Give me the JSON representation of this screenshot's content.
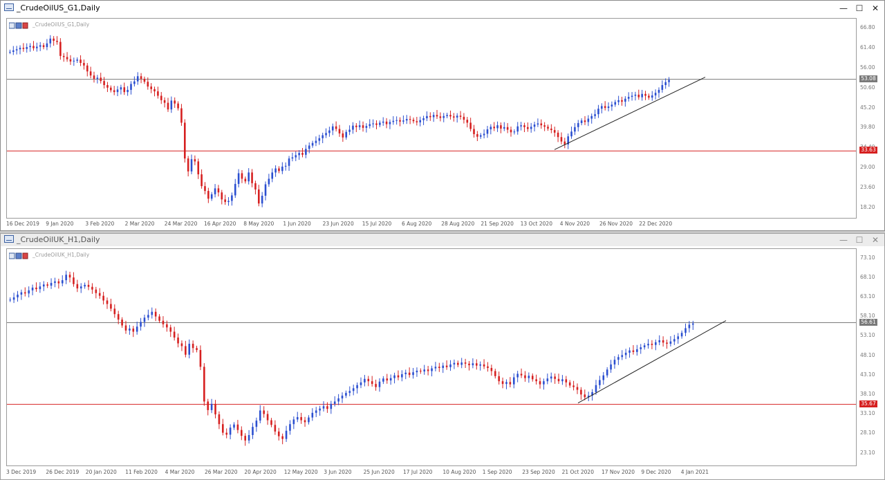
{
  "charts": [
    {
      "window_title": "_CrudeOilUS_G1,Daily",
      "chart_label": "_CrudeOilUS_G1,Daily",
      "price_labels": [
        "66.80",
        "61.40",
        "56.00",
        "50.60",
        "45.20",
        "39.80",
        "34.40",
        "29.00",
        "23.60",
        "18.20"
      ],
      "price_min": 15.5,
      "price_max": 69.5,
      "date_labels": [
        "16 Dec 2019",
        "9 Jan 2020",
        "3 Feb 2020",
        "2 Mar 2020",
        "24 Mar 2020",
        "16 Apr 2020",
        "8 May 2020",
        "1 Jun 2020",
        "23 Jun 2020",
        "15 Jul 2020",
        "6 Aug 2020",
        "28 Aug 2020",
        "21 Sep 2020",
        "13 Oct 2020",
        "4 Nov 2020",
        "26 Nov 2020",
        "22 Dec 2020"
      ],
      "hline_gray": {
        "label": "53.08",
        "value": 53.08,
        "color": "#7a7a7a"
      },
      "hline_red": {
        "label": "33.63",
        "value": 33.63,
        "color": "#d62020"
      },
      "trendline": {
        "from": {
          "bar": 0.0,
          "price": 0
        },
        "note": ""
      },
      "closes": [
        60.5,
        60.9,
        61.2,
        61.6,
        61.3,
        61.8,
        62.1,
        61.5,
        61.9,
        62.3,
        61.8,
        62.8,
        64.1,
        63.5,
        63.2,
        59.4,
        59.1,
        58.5,
        57.9,
        58.1,
        58.4,
        57.5,
        56.8,
        55.2,
        54.1,
        53.2,
        53.5,
        52.6,
        51.5,
        50.8,
        50.1,
        49.6,
        50.3,
        50.9,
        49.6,
        50.2,
        51.8,
        52.5,
        53.9,
        53.2,
        52.4,
        51.1,
        50.4,
        49.8,
        48.6,
        47.4,
        46.7,
        44.9,
        47.3,
        46.5,
        45.2,
        41.3,
        31.6,
        28.1,
        31.4,
        30.8,
        27.3,
        24.1,
        22.8,
        20.7,
        21.9,
        23.5,
        22.4,
        20.5,
        19.8,
        20.1,
        21.6,
        24.7,
        27.6,
        26.1,
        25.4,
        27.8,
        24.9,
        23.2,
        19.4,
        21.5,
        24.6,
        26.1,
        27.8,
        28.9,
        28.2,
        29.4,
        29.6,
        31.6,
        31.9,
        32.5,
        33.1,
        32.6,
        34.2,
        35.1,
        35.8,
        36.4,
        37.1,
        37.9,
        38.5,
        39.2,
        40.3,
        39.6,
        38.4,
        37.3,
        38.8,
        39.4,
        40.5,
        40.1,
        40.6,
        39.9,
        40.4,
        40.9,
        41.1,
        40.7,
        41.3,
        41.6,
        40.9,
        41.5,
        41.8,
        42.0,
        41.6,
        41.9,
        42.3,
        42.1,
        41.7,
        41.4,
        42.0,
        42.5,
        43.1,
        42.8,
        43.4,
        43.0,
        42.6,
        43.1,
        43.4,
        43.0,
        42.7,
        43.2,
        42.9,
        42.1,
        41.3,
        39.6,
        38.2,
        37.5,
        37.9,
        38.3,
        39.5,
        40.2,
        39.8,
        40.6,
        39.7,
        40.1,
        39.4,
        38.7,
        38.9,
        40.3,
        40.6,
        40.1,
        39.6,
        40.2,
        40.8,
        41.1,
        40.6,
        40.2,
        39.7,
        39.3,
        38.6,
        37.4,
        36.2,
        35.4,
        37.6,
        38.9,
        40.1,
        41.2,
        41.9,
        41.5,
        42.4,
        43.1,
        43.6,
        45.1,
        45.8,
        45.3,
        45.7,
        46.2,
        46.9,
        47.4,
        47.0,
        47.8,
        48.3,
        48.6,
        48.9,
        48.2,
        49.1,
        48.6,
        48.1,
        48.7,
        49.4,
        50.2,
        51.5,
        52.3,
        52.9
      ]
    },
    {
      "window_title": "_CrudeOilUK_H1,Daily",
      "chart_label": "_CrudeOilUK_H1,Daily",
      "price_labels": [
        "73.10",
        "68.10",
        "63.10",
        "58.10",
        "53.10",
        "48.10",
        "43.10",
        "38.10",
        "33.10",
        "28.10",
        "23.10"
      ],
      "price_min": 20.0,
      "price_max": 75.5,
      "date_labels": [
        "3 Dec 2019",
        "26 Dec 2019",
        "20 Jan 2020",
        "11 Feb 2020",
        "4 Mar 2020",
        "26 Mar 2020",
        "20 Apr 2020",
        "12 May 2020",
        "3 Jun 2020",
        "25 Jun 2020",
        "17 Jul 2020",
        "10 Aug 2020",
        "1 Sep 2020",
        "23 Sep 2020",
        "21 Oct 2020",
        "17 Nov 2020",
        "9 Dec 2020",
        "4 Jan 2021"
      ],
      "hline_gray": {
        "label": "56.61",
        "value": 56.61,
        "color": "#7a7a7a"
      },
      "hline_red": {
        "label": "35.67",
        "value": 35.67,
        "color": "#d62020"
      },
      "closes": [
        62.5,
        63.1,
        63.8,
        64.4,
        64.1,
        64.9,
        65.6,
        65.2,
        65.9,
        66.4,
        66.1,
        66.8,
        67.2,
        66.7,
        67.5,
        68.9,
        68.2,
        66.5,
        65.4,
        65.9,
        66.3,
        65.8,
        65.1,
        64.2,
        63.5,
        62.3,
        61.4,
        60.2,
        58.8,
        57.4,
        55.9,
        54.6,
        55.1,
        54.3,
        55.6,
        56.8,
        57.9,
        58.6,
        59.4,
        58.2,
        57.1,
        56.2,
        55.4,
        54.3,
        52.8,
        51.3,
        50.6,
        48.4,
        51.2,
        50.1,
        49.6,
        45.3,
        36.4,
        34.2,
        35.8,
        33.1,
        30.6,
        28.4,
        27.9,
        29.7,
        30.5,
        29.1,
        27.6,
        26.4,
        27.8,
        29.9,
        31.5,
        34.1,
        33.2,
        31.6,
        30.4,
        28.7,
        27.5,
        26.8,
        28.9,
        30.6,
        31.8,
        32.4,
        31.6,
        31.1,
        32.3,
        33.5,
        34.1,
        34.6,
        35.2,
        34.5,
        35.8,
        36.4,
        37.2,
        37.9,
        38.6,
        39.1,
        39.8,
        40.6,
        41.3,
        42.2,
        41.6,
        40.9,
        40.1,
        41.5,
        42.3,
        41.8,
        42.4,
        43.1,
        42.6,
        43.4,
        43.8,
        43.2,
        43.9,
        44.3,
        44.1,
        44.6,
        44.2,
        44.9,
        45.3,
        45.0,
        45.6,
        45.2,
        45.9,
        46.3,
        45.8,
        46.4,
        46.1,
        45.7,
        46.2,
        45.6,
        45.9,
        45.4,
        45.0,
        44.2,
        42.9,
        41.6,
        40.9,
        41.4,
        40.8,
        42.6,
        43.5,
        43.1,
        42.4,
        43.0,
        42.1,
        41.6,
        40.8,
        41.6,
        42.3,
        42.8,
        42.2,
        41.6,
        42.1,
        41.3,
        40.5,
        40.1,
        39.4,
        38.2,
        37.5,
        37.9,
        38.8,
        40.6,
        41.9,
        43.1,
        44.6,
        45.9,
        47.1,
        47.8,
        48.3,
        48.9,
        49.5,
        49.1,
        49.8,
        50.3,
        50.8,
        51.2,
        50.9,
        51.6,
        52.1,
        51.5,
        51.2,
        51.8,
        52.4,
        53.1,
        54.0,
        55.2,
        56.1,
        56.4
      ]
    }
  ]
}
